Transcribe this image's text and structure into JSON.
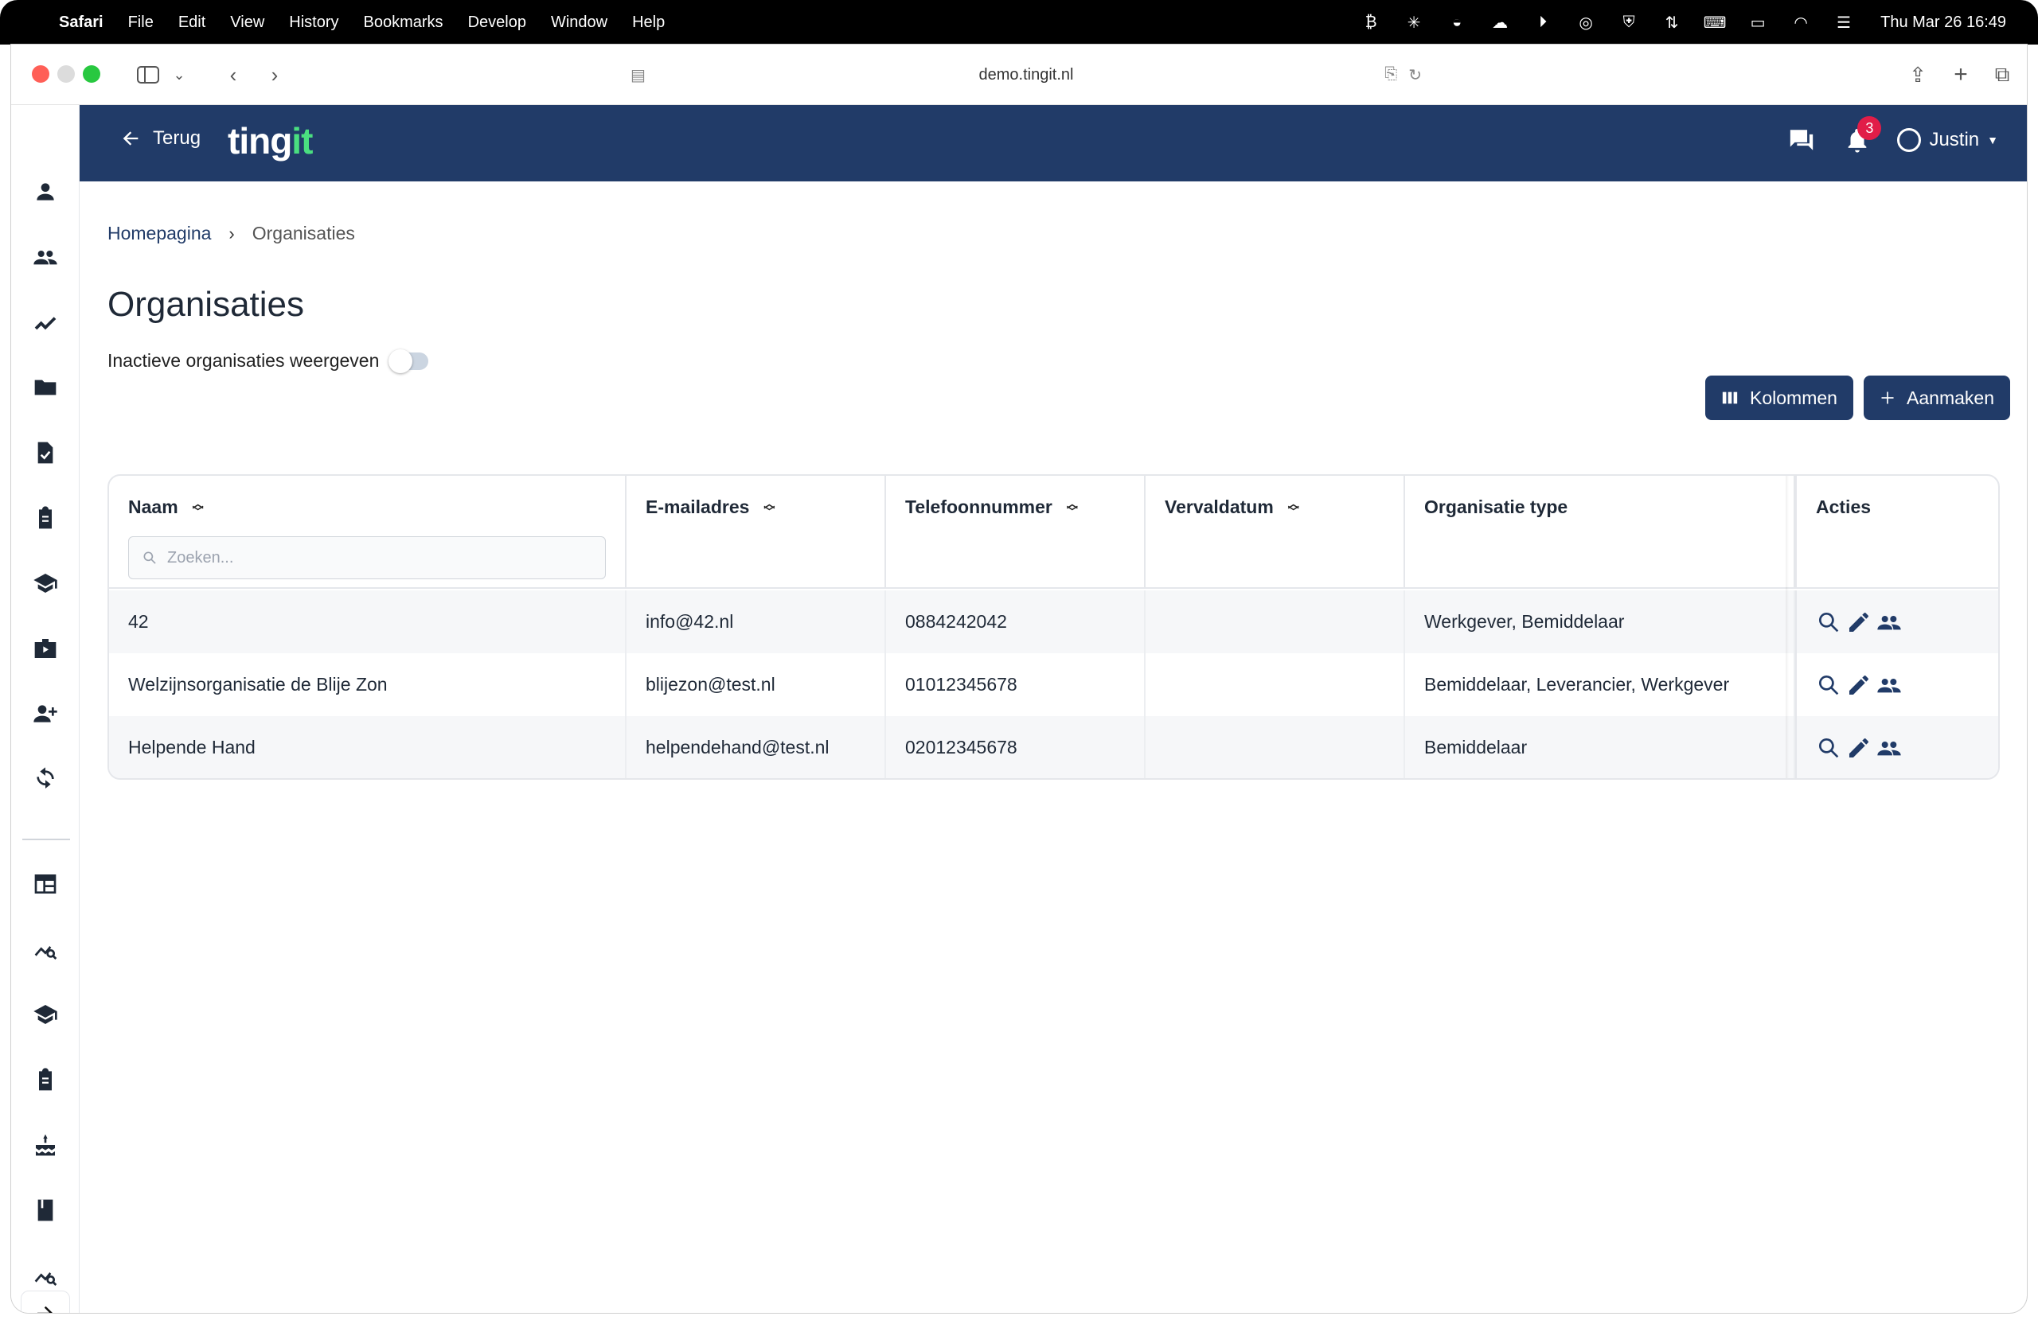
{
  "menubar": {
    "app": "Safari",
    "items": [
      "File",
      "Edit",
      "View",
      "History",
      "Bookmarks",
      "Develop",
      "Window",
      "Help"
    ],
    "clock": "Thu Mar 26  16:49"
  },
  "browser": {
    "url": "demo.tingit.nl"
  },
  "header": {
    "back_label": "Terug",
    "logo_main": "ting",
    "logo_accent": "it",
    "notification_count": "3",
    "user_name": "Justin"
  },
  "breadcrumb": {
    "home": "Homepagina",
    "current": "Organisaties"
  },
  "page": {
    "title": "Organisaties",
    "toggle_label": "Inactieve organisaties weergeven",
    "toggle_on": false
  },
  "buttons": {
    "columns": "Kolommen",
    "create": "Aanmaken"
  },
  "table": {
    "headers": {
      "name": "Naam",
      "email": "E-mailadres",
      "phone": "Telefoonnummer",
      "expiry": "Vervaldatum",
      "type": "Organisatie type",
      "actions": "Acties"
    },
    "search_placeholder": "Zoeken...",
    "rows": [
      {
        "name": "42",
        "email": "info@42.nl",
        "phone": "0884242042",
        "expiry": "",
        "type": "Werkgever, Bemiddelaar"
      },
      {
        "name": "Welzijnsorganisatie de Blije Zon",
        "email": "blijezon@test.nl",
        "phone": "01012345678",
        "expiry": "",
        "type": "Bemiddelaar, Leverancier, Werkgever"
      },
      {
        "name": "Helpende Hand",
        "email": "helpendehand@test.nl",
        "phone": "02012345678",
        "expiry": "",
        "type": "Bemiddelaar"
      }
    ]
  },
  "colors": {
    "brand": "#213b68",
    "logo_accent": "#4ade80",
    "badge": "#e11d48"
  }
}
